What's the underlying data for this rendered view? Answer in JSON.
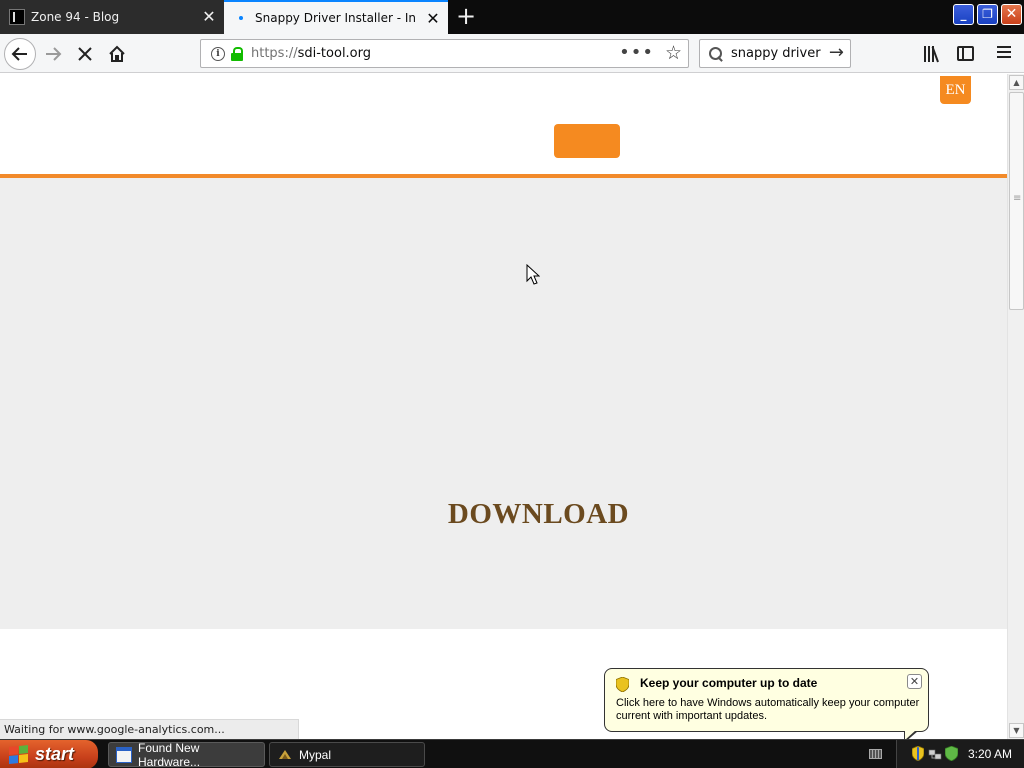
{
  "browser": {
    "tabs": [
      {
        "title": "Zone 94 - Blog",
        "active": false
      },
      {
        "title": "Snappy Driver Installer - Install and update drivers",
        "active": true
      }
    ],
    "new_tab_label": "+",
    "window_controls": {
      "minimize": "_",
      "restore": "❐",
      "close": "✕"
    }
  },
  "navbar": {
    "back_icon": "arrow-left-icon",
    "forward_icon": "arrow-right-icon",
    "stop_icon": "close-icon",
    "home_icon": "home-icon",
    "url_scheme": "https://",
    "url_host": "sdi-tool.org",
    "page_actions_label": "•••",
    "search_value": "snappy driver"
  },
  "page": {
    "lang_button": "EN",
    "heading": "DOWNLOAD",
    "accent_color": "#f58a20"
  },
  "status_bar": {
    "text": "Waiting for www.google-analytics.com..."
  },
  "balloon": {
    "title": "Keep your computer up to date",
    "body": "Click here to have Windows automatically keep your computer current with important updates."
  },
  "taskbar": {
    "start_label": "start",
    "buttons": [
      {
        "label": "Found New Hardware...",
        "icon": "hardware-window-icon"
      },
      {
        "label": "Mypal",
        "icon": "mypal-icon"
      }
    ],
    "clock": "3:20 AM"
  }
}
